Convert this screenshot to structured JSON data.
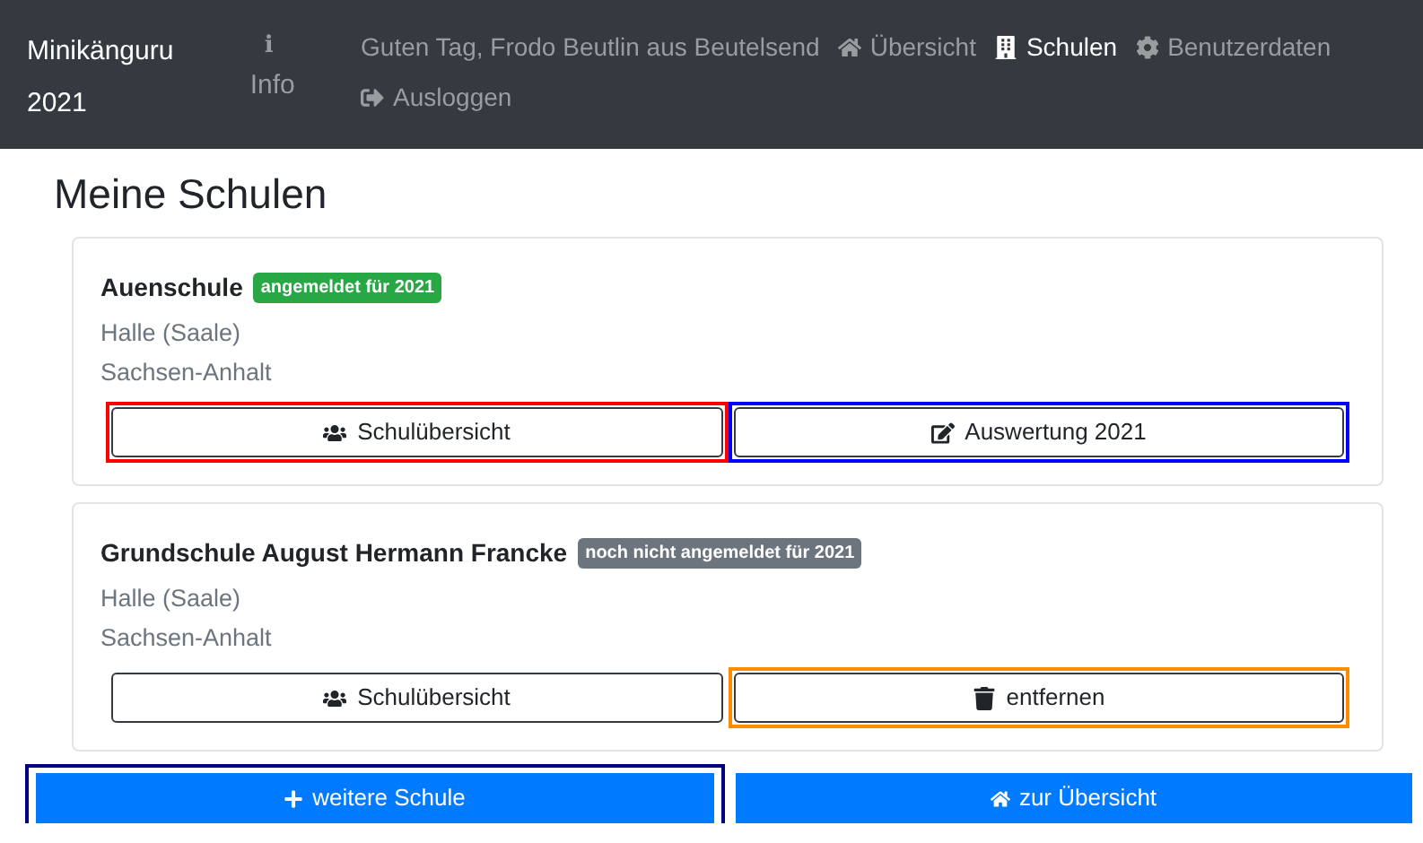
{
  "navbar": {
    "brand": [
      "Minikänguru",
      "2021"
    ],
    "info": {
      "icon": "i",
      "label": "Info"
    },
    "greeting": "Guten Tag, Frodo Beutlin aus Beutelsend",
    "links": [
      {
        "kind": "home",
        "label": "Übersicht",
        "selected": false
      },
      {
        "kind": "building",
        "label": "Schulen",
        "selected": true
      },
      {
        "kind": "gear",
        "label": "Benutzerdaten",
        "selected": false
      },
      {
        "kind": "logout",
        "label": "Ausloggen",
        "selected": false
      }
    ]
  },
  "title": "Meine Schulen",
  "schools": [
    {
      "name": "Auenschule",
      "badge": {
        "label": "angemeldet für 2021",
        "color": "#28a745"
      },
      "city": "Halle (Saale)",
      "state": "Sachsen-Anhalt",
      "buttons": [
        {
          "kind": "users",
          "label": "Schulübersicht",
          "color": "#ff0000"
        },
        {
          "kind": "edit",
          "label": "Auswertung 2021",
          "color": "#0000ff"
        }
      ]
    },
    {
      "name": "Grundschule August Hermann Francke",
      "badge": {
        "label": "noch nicht angemeldet für 2021",
        "color": "#6c757d"
      },
      "city": "Halle (Saale)",
      "state": "Sachsen-Anhalt",
      "buttons": [
        {
          "kind": "users",
          "label": "Schulübersicht"
        },
        {
          "kind": "trash",
          "label": "entfernen",
          "color": "#ff8c00"
        }
      ]
    }
  ],
  "actions": [
    {
      "kind": "plus",
      "label": "weitere Schule",
      "color": "#000080"
    },
    {
      "kind": "home",
      "label": "zur Übersicht"
    }
  ]
}
